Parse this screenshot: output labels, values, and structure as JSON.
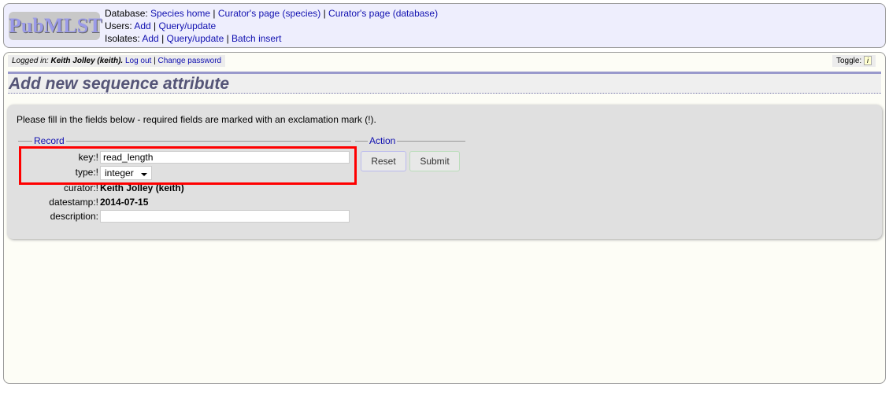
{
  "logo": "PubMLST",
  "nav": {
    "database": {
      "label": "Database:",
      "links": [
        "Species home",
        "Curator's page (species)",
        "Curator's page (database)"
      ]
    },
    "users": {
      "label": "Users:",
      "links": [
        "Add",
        "Query/update"
      ]
    },
    "isolates": {
      "label": "Isolates:",
      "links": [
        "Add",
        "Query/update",
        "Batch insert"
      ]
    }
  },
  "login": {
    "prefix": "Logged in:",
    "user": "Keith Jolley (keith).",
    "logout": "Log out",
    "change_password": "Change password"
  },
  "toggle": {
    "label": "Toggle:",
    "icon": "i"
  },
  "page_title": "Add new sequence attribute",
  "form": {
    "intro": "Please fill in the fields below - required fields are marked with an exclamation mark (!).",
    "record_legend": "Record",
    "action_legend": "Action",
    "fields": {
      "key": {
        "label": "key:!",
        "value": "read_length"
      },
      "type": {
        "label": "type:!",
        "value": "integer"
      },
      "curator": {
        "label": "curator:!",
        "value": "Keith Jolley (keith)"
      },
      "datestamp": {
        "label": "datestamp:!",
        "value": "2014-07-15"
      },
      "description": {
        "label": "description:",
        "value": ""
      }
    },
    "reset": "Reset",
    "submit": "Submit"
  },
  "highlight_color": "#ff0000"
}
